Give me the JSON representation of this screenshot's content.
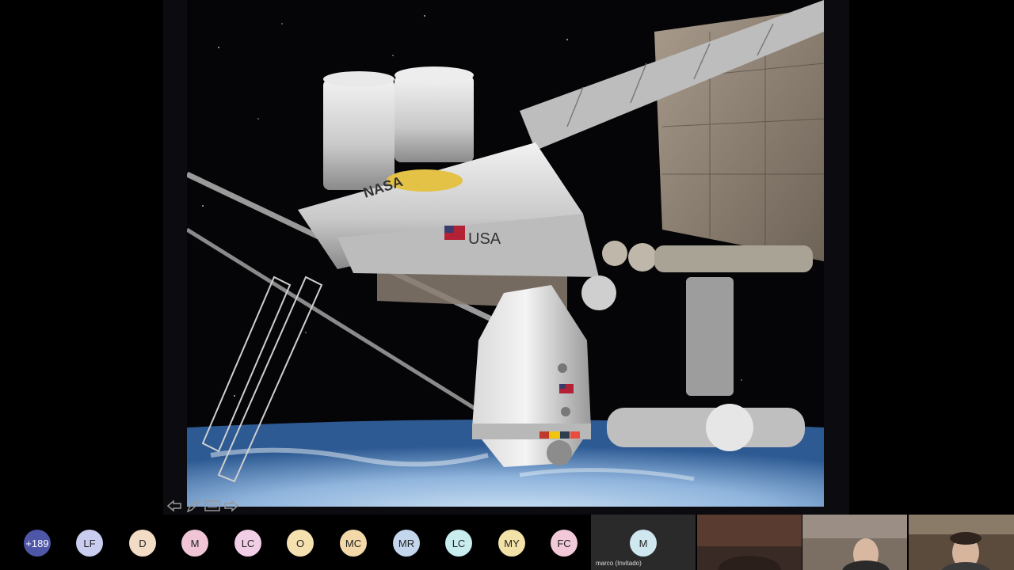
{
  "slide": {
    "logo_text": "NASA",
    "module_text": "USA"
  },
  "toolbar": {
    "prev_icon": "arrow-left-icon",
    "pen_icon": "pen-icon",
    "menu_icon": "slide-menu-icon",
    "next_icon": "arrow-right-icon"
  },
  "participants": {
    "overflow_count": "+189",
    "avatars": [
      {
        "initials": "LF",
        "color": "#c9cdf0"
      },
      {
        "initials": "D",
        "color": "#f2dcc6"
      },
      {
        "initials": "M",
        "color": "#f0c6d6"
      },
      {
        "initials": "LC",
        "color": "#f1cde6"
      },
      {
        "initials": "O",
        "color": "#f5e0b0"
      },
      {
        "initials": "MC",
        "color": "#f3d9a9"
      },
      {
        "initials": "MR",
        "color": "#c3d6ee"
      },
      {
        "initials": "LC",
        "color": "#c9ecef"
      },
      {
        "initials": "MY",
        "color": "#f3e2a8"
      },
      {
        "initials": "FC",
        "color": "#f1c9d9"
      }
    ],
    "overflow_color": "#4e56a8",
    "guest_tile": {
      "initial": "M",
      "name": "marco (Invitado)",
      "color": "#cfe7ef"
    }
  }
}
